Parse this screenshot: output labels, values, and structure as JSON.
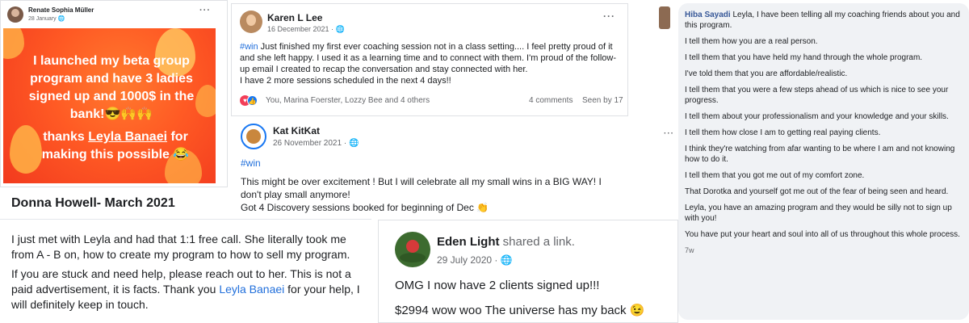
{
  "card1": {
    "author": "Renate Sophia Müller",
    "date": "28 January",
    "banner_line1": "I launched my beta group program and have 3 ladies signed up and 1000$ in the bank!😎🙌🙌",
    "banner_line2_pre": "thanks ",
    "banner_line2_link": "Leyla Banaei",
    "banner_line2_post": " for making this possible 😂"
  },
  "donna": {
    "title": "Donna Howell- March 2021",
    "p1": "I just met with Leyla and had that 1:1 free call. She literally took me from A - B on, how to create my program to how to sell my program.",
    "p2_pre": "If you are stuck and need help, please reach out to her. This is not a paid advertisement, it is facts. Thank you ",
    "p2_link": "Leyla Banaei",
    "p2_post": " for your help, I will definitely keep in touch."
  },
  "karen": {
    "author": "Karen L Lee",
    "date": "16 December 2021 · ",
    "hashtag": "#win",
    "body1": "  Just finished my first ever coaching session not in a class setting....  I feel pretty proud of it and she left happy.  I used it as a learning time and to connect with them.  I'm proud of the follow-up email I created to recap the conversation and stay connected with her.",
    "body2": "I have 2 more sessions scheduled in the next 4 days!!",
    "reactions": "You, Marina Foerster, Lozzy Bee and 4 others",
    "comments": "4 comments",
    "seen": "Seen by 17"
  },
  "kat": {
    "author": "Kat KitKat",
    "date": "26 November 2021 · ",
    "hashtag": "#win",
    "body1": "This might be over excitement ! But I will celebrate all my small wins in a BIG WAY! I don't play small anymore!",
    "body2": "Got 4 Discovery sessions booked for beginning of Dec 👏"
  },
  "eden": {
    "author": "Eden Light",
    "action": " shared a link.",
    "date": "29 July 2020 · ",
    "body1": "OMG I now have 2 clients signed up!!!",
    "body2": "$2994 wow woo The universe has my back 😉"
  },
  "hiba": {
    "author": "Hiba Sayadi",
    "intro": " Leyla, I have been telling all my coaching friends about you and this program.",
    "lines": [
      "I tell them how you are a real person.",
      "I tell them that you have held my hand through the whole program.",
      "I've told them that you are affordable/realistic.",
      "I tell them that you were a few steps ahead of us which is nice to see your progress.",
      "I tell them about your professionalism and your knowledge and your skills.",
      "I tell them how close I am to getting real paying clients.",
      "I think they're watching from afar wanting to be where I am and not knowing how to do it.",
      "I tell them that you got me out of my comfort zone.",
      "That Dorotka and yourself got me out of the fear of being seen and heard.",
      "Leyla, you have an amazing program and they would be silly not to sign up with you!",
      "You have put your heart and soul into all of us throughout this whole process."
    ],
    "time": "7w"
  },
  "ui": {
    "more": "···",
    "globe": "🌐"
  },
  "colors": {
    "link": "#216fdb",
    "banner": "#ff5a24"
  }
}
